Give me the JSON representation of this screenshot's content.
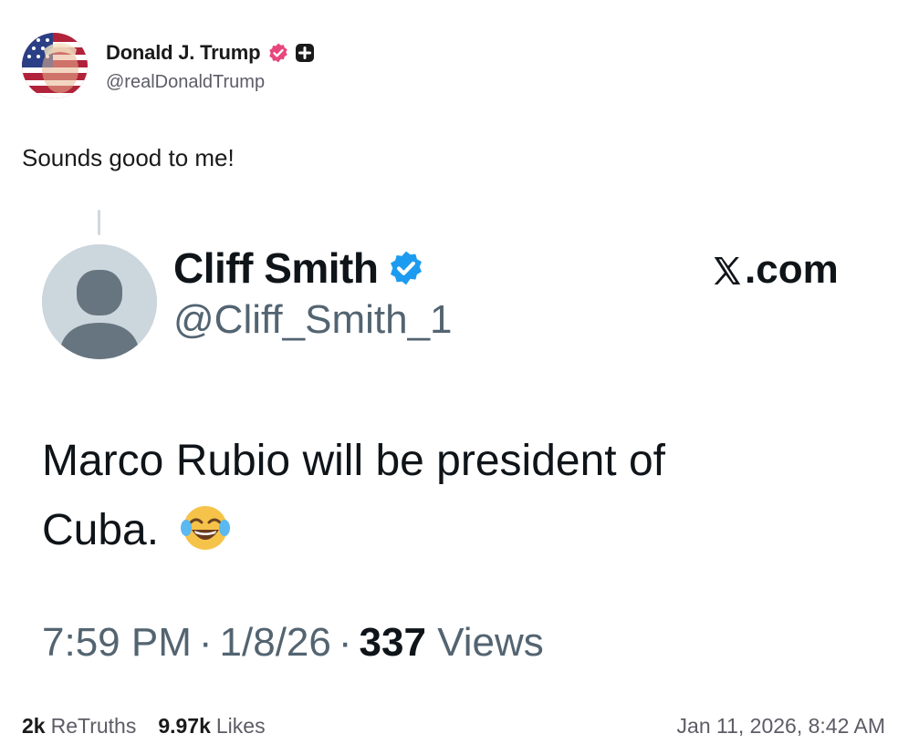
{
  "post": {
    "author_name": "Donald J. Trump",
    "author_handle": "@realDonaldTrump",
    "text": "Sounds good to me!"
  },
  "embed": {
    "author_name": "Cliff Smith",
    "author_handle": "@Cliff_Smith_1",
    "source": ".com",
    "body": "Marco Rubio will be president of Cuba.",
    "time": "7:59 PM",
    "date": "1/8/26",
    "views_count": "337",
    "views_label": "Views"
  },
  "footer": {
    "retruths_count": "2k",
    "retruths_label": "ReTruths",
    "likes_count": "9.97k",
    "likes_label": "Likes",
    "timestamp": "Jan 11, 2026, 8:42 AM"
  },
  "colors": {
    "truth_verified": "#e8467c",
    "x_verified": "#1d9bf0",
    "muted_text": "#536471"
  },
  "icons": {
    "verified_pink": "verified-badge-icon",
    "plus": "plus-badge-icon",
    "verified_blue": "verified-badge-icon",
    "x_logo": "x-logo-icon",
    "emoji": "face-with-tears-of-joy-icon"
  }
}
